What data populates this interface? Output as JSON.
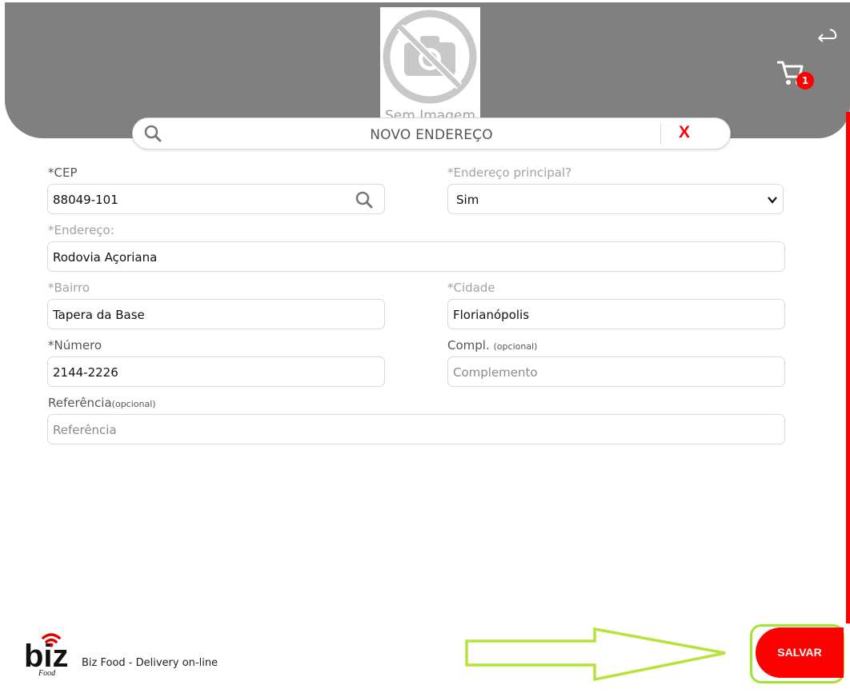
{
  "header": {
    "logo_caption": "Sem Imagem",
    "cart_count": "1",
    "icons": [
      "no-image-icon",
      "back-arrow-icon",
      "cart-icon"
    ]
  },
  "title_bar": {
    "title": "NOVO ENDEREÇO",
    "close_label": "X",
    "icons": [
      "search-icon"
    ]
  },
  "form": {
    "cep": {
      "label": "*CEP",
      "value": "88049-101"
    },
    "principal": {
      "label": "*Endereço principal?",
      "value": "Sim"
    },
    "endereco": {
      "label": "*Endereço:",
      "value": "Rodovia Açoriana"
    },
    "bairro": {
      "label": "*Bairro",
      "value": "Tapera da Base"
    },
    "cidade": {
      "label": "*Cidade",
      "value": "Florianópolis"
    },
    "numero": {
      "label": "*Número",
      "value": "2144-2226"
    },
    "compl": {
      "label": "Compl.",
      "label_small": "(opcional)",
      "placeholder": "Complemento"
    },
    "referencia": {
      "label": "Referência",
      "label_small": "(opcional)",
      "placeholder": "Referência"
    }
  },
  "footer": {
    "brand": "Biz Food - Delivery on-line",
    "logo_text": "biz",
    "logo_sub": "Food",
    "save_label": "SALVAR"
  },
  "colors": {
    "header_bg": "#808080",
    "accent_red": "#ff0000",
    "highlight_green": "#a6e22e"
  }
}
